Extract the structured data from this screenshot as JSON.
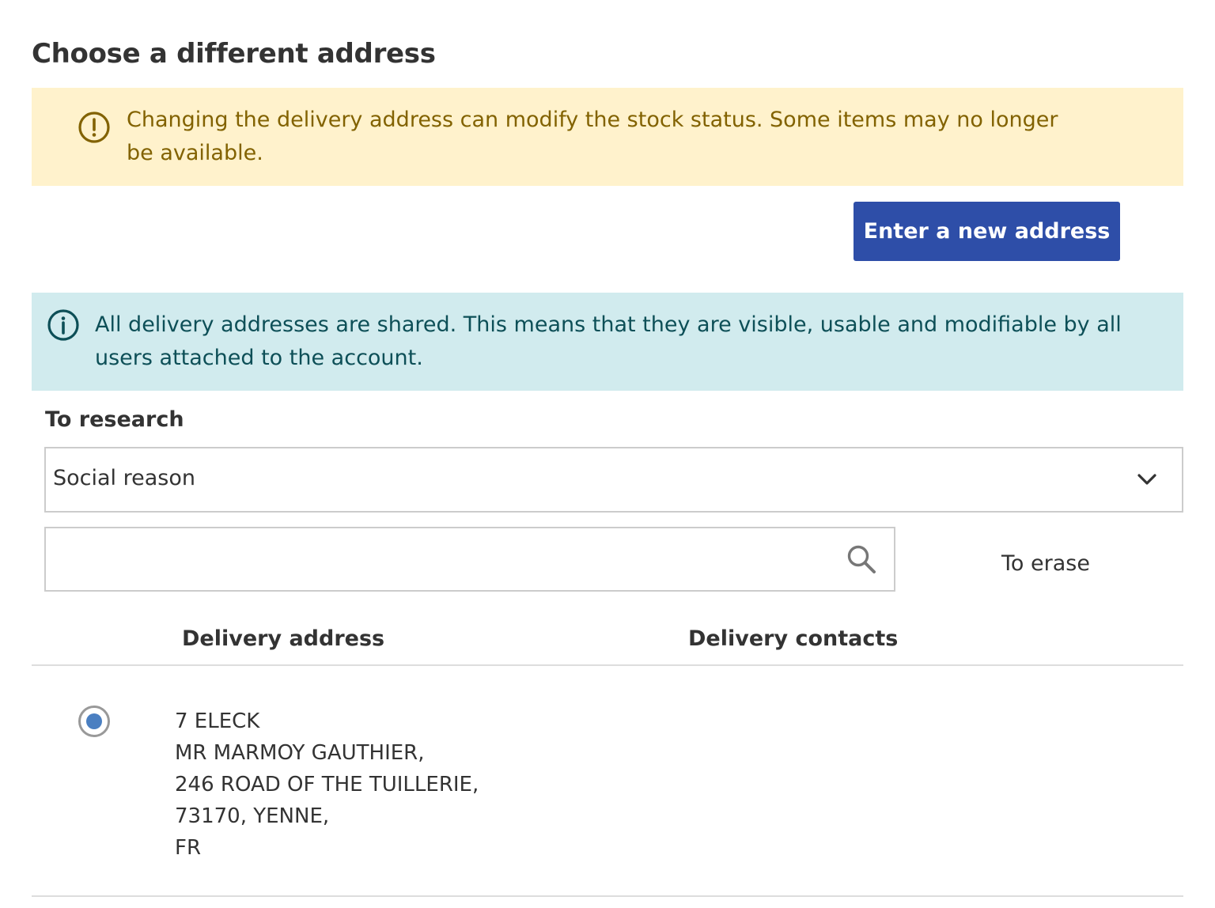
{
  "page_title": "Choose a different address",
  "warning": {
    "text": "Changing the delivery address can modify the stock status. Some items may no longer be available."
  },
  "new_address_button": "Enter a new address",
  "info": {
    "text": "All delivery addresses are shared. This means that they are visible, usable and modifiable by all users attached to the account."
  },
  "search": {
    "label": "To research",
    "field_select": "Social reason",
    "query": "",
    "erase_label": "To erase"
  },
  "table": {
    "headers": {
      "address": "Delivery address",
      "contacts": "Delivery contacts"
    },
    "rows": [
      {
        "selected": true,
        "address_lines": [
          "7 ELECK",
          "MR MARMOY GAUTHIER,",
          "246 ROAD OF THE TUILLERIE,",
          "73170, YENNE,",
          "FR"
        ],
        "contacts": ""
      }
    ]
  },
  "colors": {
    "warning_bg": "#fff2cc",
    "warning_text": "#826200",
    "info_bg": "#d1ebee",
    "info_text": "#0d4f57",
    "primary_button": "#2e4ea8",
    "radio_selected": "#4a7fc1"
  },
  "icons": {
    "warning": "exclamation-circle-icon",
    "info": "info-circle-icon",
    "dropdown": "chevron-down-icon",
    "search": "search-icon"
  }
}
